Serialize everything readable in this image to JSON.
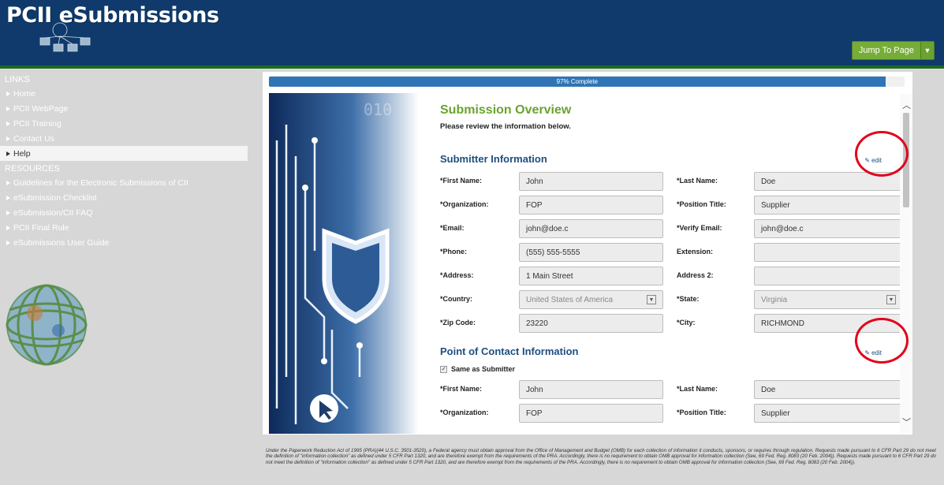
{
  "header": {
    "logo_text": "PCII eSubmissions",
    "jump_label": "Jump To Page",
    "brand_color": "#0f3a6b",
    "accent_color": "#6aa32f"
  },
  "sidebar": {
    "links_heading": "LINKS",
    "links": [
      {
        "label": "Home"
      },
      {
        "label": "PCII WebPage"
      },
      {
        "label": "PCII Training"
      },
      {
        "label": "Contact Us"
      },
      {
        "label": "Help",
        "active": true
      }
    ],
    "resources_heading": "RESOURCES",
    "resources": [
      {
        "label": "Guidelines for the Electronic Submissions of CII"
      },
      {
        "label": "eSubmission Checklist"
      },
      {
        "label": "eSubmission/CII FAQ"
      },
      {
        "label": "PCII Final Rule"
      },
      {
        "label": "eSubmissions User Guide"
      }
    ]
  },
  "progress": {
    "label": "97% Complete",
    "value": 0.97
  },
  "overview": {
    "title": "Submission Overview",
    "subtitle": "Please review the information below."
  },
  "submitter": {
    "title": "Submitter Information",
    "edit_label": "edit",
    "first_name_label": "*First Name:",
    "first_name": "John",
    "last_name_label": "*Last Name:",
    "last_name": "Doe",
    "org_label": "*Organization:",
    "org": "FOP",
    "position_label": "*Position Title:",
    "position": "Supplier",
    "email_label": "*Email:",
    "email": "john@doe.c",
    "verify_email_label": "*Verify Email:",
    "verify_email": "john@doe.c",
    "phone_label": "*Phone:",
    "phone": "(555) 555-5555",
    "extension_label": "Extension:",
    "extension": "",
    "address_label": "*Address:",
    "address": "1 Main Street",
    "address2_label": "Address 2:",
    "address2": "",
    "country_label": "*Country:",
    "country": "United States of America",
    "state_label": "*State:",
    "state": "Virginia",
    "zip_label": "*Zip Code:",
    "zip": "23220",
    "city_label": "*City:",
    "city": "RICHMOND"
  },
  "contact": {
    "title": "Point of Contact Information",
    "edit_label": "edit",
    "same_as_label": "Same as Submitter",
    "first_name_label": "*First Name:",
    "first_name": "John",
    "last_name_label": "*Last Name:",
    "last_name": "Doe",
    "org_label": "*Organization:",
    "org": "FOP",
    "position_label": "*Position Title:",
    "position": "Supplier"
  },
  "footer": {
    "text": "Under the Paperwork Reduction Act of 1995 (PRA)(44 U.S.C. 3501-3520), a Federal agency must obtain approval from the Office of Management and Budget (OMB) for each collection of information it conducts, sponsors, or requires through regulation. Requests made pursuant to 6 CFR Part 29 do not meet the definition of \"information collection\" as defined under 5 CFR Part 1320, and are therefore exempt from the requirements of the PRA. Accordingly, there is no requirement to obtain OMB approval for information collection (See, 69 Fed. Reg. 8083 (20 Feb. 2004)). Requests made pursuant to 6 CFR Part 29 do not meet the definition of \"information collection\" as defined under 5 CFR Part 1320, and are therefore exempt from the requirements of the PRA. Accordingly, there is no requirement to obtain OMB approval for information collection (See, 69 Fed. Reg. 8083 (20 Feb. 2004))."
  }
}
